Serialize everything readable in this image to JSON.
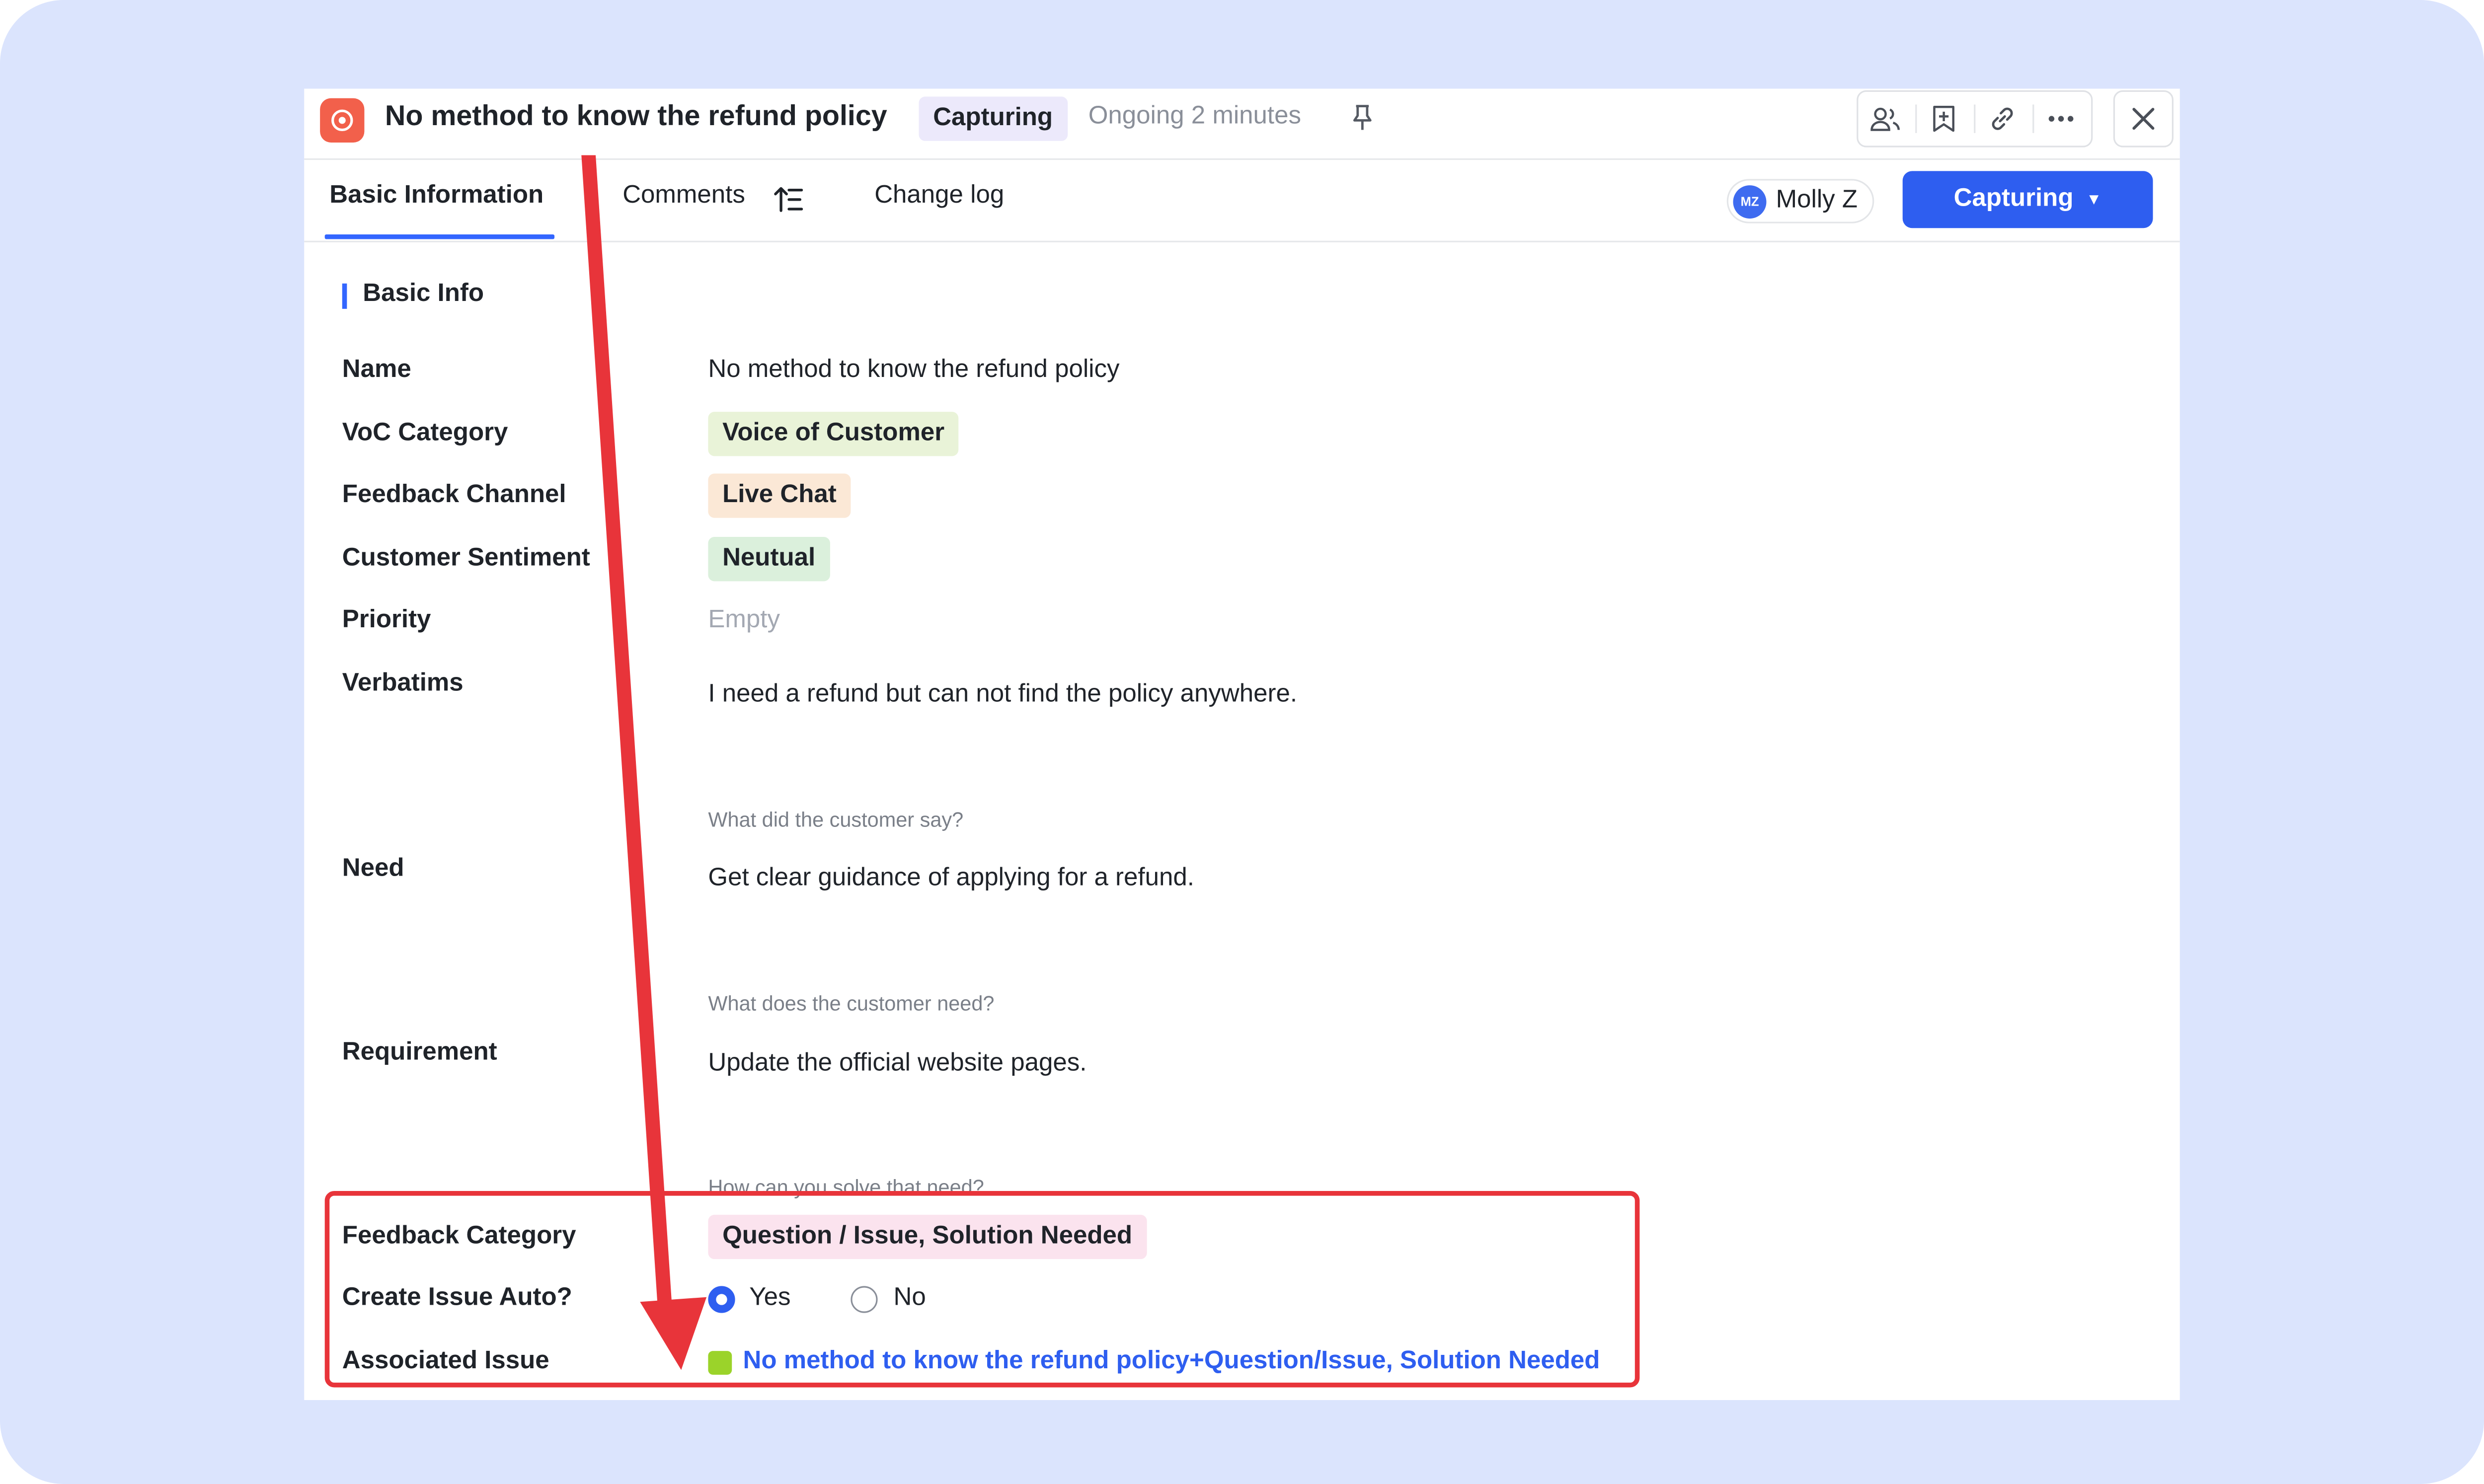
{
  "header": {
    "title": "No method to know the refund policy",
    "status": "Capturing",
    "ongoing": "Ongoing 2 minutes"
  },
  "tabs": [
    {
      "label": "Basic Information",
      "active": true
    },
    {
      "label": "Comments"
    },
    {
      "label": "Change log"
    }
  ],
  "assignee": {
    "initials": "MZ",
    "name": "Molly Z"
  },
  "status_button": {
    "label": "Capturing"
  },
  "section": {
    "title": "Basic Info"
  },
  "fields": {
    "name": {
      "label": "Name",
      "value": "No method to know the refund policy"
    },
    "voc_category": {
      "label": "VoC Category",
      "value": "Voice of Customer",
      "color": "#e9f3d8"
    },
    "feedback_channel": {
      "label": "Feedback Channel",
      "value": "Live Chat",
      "color": "#fbe8d6"
    },
    "customer_sentiment": {
      "label": "Customer Sentiment",
      "value": "Neutual",
      "color": "#dbf0dc"
    },
    "priority": {
      "label": "Priority",
      "value": "Empty"
    },
    "verbatims": {
      "label": "Verbatims",
      "value": "I need a refund but can not find the policy anywhere.",
      "hint": "What did the customer say?"
    },
    "need": {
      "label": "Need",
      "value": "Get clear guidance of applying for a refund.",
      "hint": "What does the customer need?"
    },
    "requirement": {
      "label": "Requirement",
      "value": "Update the official website pages.",
      "hint": "How can you solve that need?"
    },
    "feedback_category": {
      "label": "Feedback Category",
      "value": "Question / Issue, Solution Needed",
      "color": "#fbe3ee"
    },
    "create_issue_auto": {
      "label": "Create Issue Auto?",
      "options": [
        "Yes",
        "No"
      ],
      "selected": "Yes"
    },
    "associated_issue": {
      "label": "Associated Issue",
      "value": "No method to know the refund policy+Question/Issue, Solution Needed",
      "color": "#9bd32a"
    }
  },
  "colors": {
    "accent": "#2e5ef0",
    "annotation": "#e8343a",
    "background": "#dbe4fd"
  }
}
